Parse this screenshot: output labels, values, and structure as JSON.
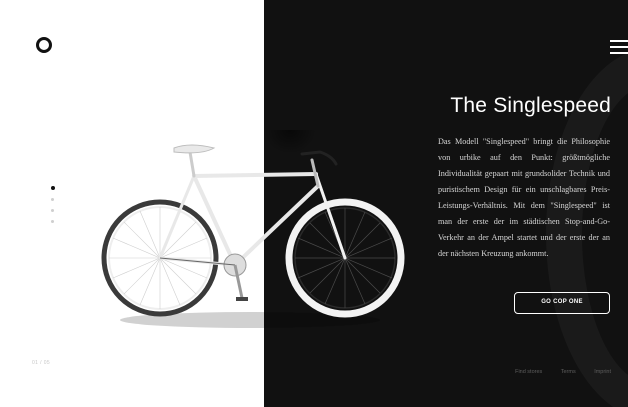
{
  "hero": {
    "title": "The Singlespeed",
    "description": "Das Modell \"Singlespeed\" bringt die Philosophie von urbike auf den Punkt: größtmögliche Individualität gepaart mit grundsolider Technik und puristischem Design für ein unschlagbares Preis-Leistungs-Verhältnis. Mit dem \"Singlespeed\" ist man der erste der im städtischen Stop-and-Go-Verkehr an der Ampel startet und der erste der an der nächsten Kreuzung ankommt.",
    "cta_label": "GO COP ONE"
  },
  "pagination": {
    "indicator": "01 / 05",
    "total_dots": 4,
    "active_index": 0
  },
  "footer": {
    "links": [
      "Find stores",
      "Terms",
      "Imprint"
    ]
  },
  "colors": {
    "dark_panel": "#111111",
    "light_panel": "#ffffff",
    "accent": "#ffffff"
  },
  "icons": {
    "logo": "circle-logo-icon",
    "menu": "hamburger-menu-icon",
    "product": "singlespeed-bicycle"
  }
}
